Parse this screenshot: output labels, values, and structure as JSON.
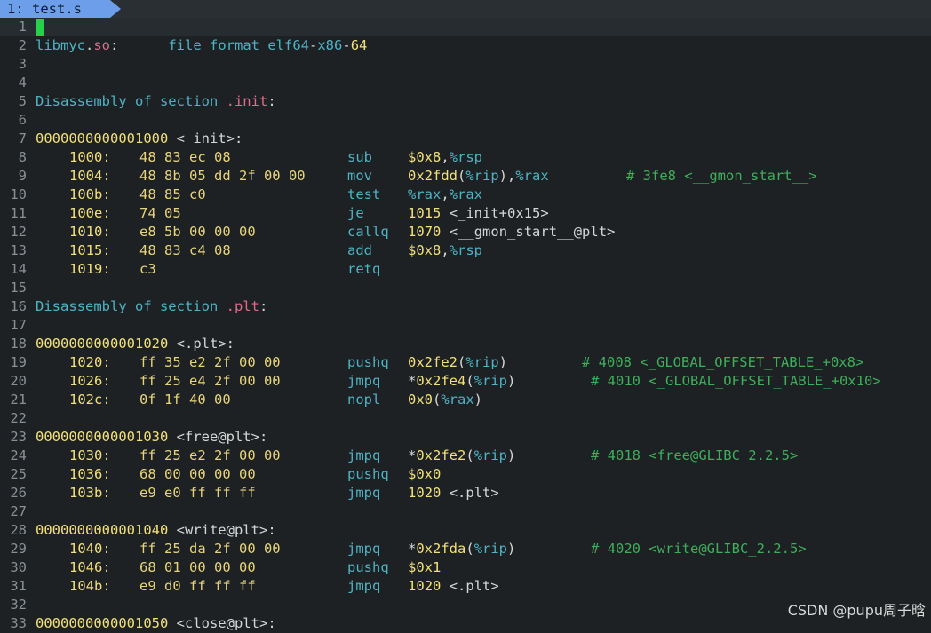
{
  "tab": {
    "label": "1: test.s"
  },
  "watermark": "CSDN @pupu周子晗",
  "lines": [
    {
      "n": "1",
      "kind": "cursor"
    },
    {
      "n": "2",
      "kind": "header",
      "a": "libmyc.so:",
      "b": "     file format elf64-x86-64"
    },
    {
      "n": "3",
      "kind": "blank"
    },
    {
      "n": "4",
      "kind": "blank"
    },
    {
      "n": "5",
      "kind": "section",
      "a": "Disassembly of section ",
      "b": ".init",
      ":": ":"
    },
    {
      "n": "6",
      "kind": "blank"
    },
    {
      "n": "7",
      "kind": "label",
      "a": "0000000000001000 <_init>:"
    },
    {
      "n": "8",
      "kind": "ins",
      "addr": "1000:",
      "bytes": "48 83 ec 08",
      "mn": "sub",
      "ops": "$0x8,%rsp",
      "cm": ""
    },
    {
      "n": "9",
      "kind": "ins",
      "addr": "1004:",
      "bytes": "48 8b 05 dd 2f 00 00",
      "mn": "mov",
      "ops": "0x2fdd(%rip),%rax",
      "cm": "# 3fe8 <__gmon_start__>",
      "cmx": "705"
    },
    {
      "n": "10",
      "kind": "ins",
      "addr": "100b:",
      "bytes": "48 85 c0",
      "mn": "test",
      "ops": "%rax,%rax",
      "cm": ""
    },
    {
      "n": "11",
      "kind": "ins",
      "addr": "100e:",
      "bytes": "74 05",
      "mn": "je",
      "ops": "1015 <_init+0x15>",
      "cm": ""
    },
    {
      "n": "12",
      "kind": "ins",
      "addr": "1010:",
      "bytes": "e8 5b 00 00 00",
      "mn": "callq",
      "ops": "1070 <__gmon_start__@plt>",
      "cm": ""
    },
    {
      "n": "13",
      "kind": "ins",
      "addr": "1015:",
      "bytes": "48 83 c4 08",
      "mn": "add",
      "ops": "$0x8,%rsp",
      "cm": ""
    },
    {
      "n": "14",
      "kind": "ins",
      "addr": "1019:",
      "bytes": "c3",
      "mn": "retq",
      "ops": "",
      "cm": ""
    },
    {
      "n": "15",
      "kind": "blank"
    },
    {
      "n": "16",
      "kind": "section",
      "a": "Disassembly of section ",
      "b": ".plt",
      ":": ":"
    },
    {
      "n": "17",
      "kind": "blank"
    },
    {
      "n": "18",
      "kind": "label",
      "a": "0000000000001020 <.plt>:"
    },
    {
      "n": "19",
      "kind": "ins",
      "addr": "1020:",
      "bytes": "ff 35 e2 2f 00 00",
      "mn": "pushq",
      "ops": "0x2fe2(%rip)",
      "cm": "# 4008 <_GLOBAL_OFFSET_TABLE_+0x8>",
      "cmx": "655"
    },
    {
      "n": "20",
      "kind": "ins",
      "addr": "1026:",
      "bytes": "ff 25 e4 2f 00 00",
      "mn": "jmpq",
      "ops": "*0x2fe4(%rip)",
      "cm": "# 4010 <_GLOBAL_OFFSET_TABLE_+0x10>",
      "cmx": "665"
    },
    {
      "n": "21",
      "kind": "ins",
      "addr": "102c:",
      "bytes": "0f 1f 40 00",
      "mn": "nopl",
      "ops": "0x0(%rax)",
      "cm": ""
    },
    {
      "n": "22",
      "kind": "blank"
    },
    {
      "n": "23",
      "kind": "label",
      "a": "0000000000001030 <free@plt>:"
    },
    {
      "n": "24",
      "kind": "ins",
      "addr": "1030:",
      "bytes": "ff 25 e2 2f 00 00",
      "mn": "jmpq",
      "ops": "*0x2fe2(%rip)",
      "cm": "# 4018 <free@GLIBC_2.2.5>",
      "cmx": "665"
    },
    {
      "n": "25",
      "kind": "ins",
      "addr": "1036:",
      "bytes": "68 00 00 00 00",
      "mn": "pushq",
      "ops": "$0x0",
      "cm": ""
    },
    {
      "n": "26",
      "kind": "ins",
      "addr": "103b:",
      "bytes": "e9 e0 ff ff ff",
      "mn": "jmpq",
      "ops": "1020 <.plt>",
      "cm": ""
    },
    {
      "n": "27",
      "kind": "blank"
    },
    {
      "n": "28",
      "kind": "label",
      "a": "0000000000001040 <write@plt>:"
    },
    {
      "n": "29",
      "kind": "ins",
      "addr": "1040:",
      "bytes": "ff 25 da 2f 00 00",
      "mn": "jmpq",
      "ops": "*0x2fda(%rip)",
      "cm": "# 4020 <write@GLIBC_2.2.5>",
      "cmx": "665"
    },
    {
      "n": "30",
      "kind": "ins",
      "addr": "1046:",
      "bytes": "68 01 00 00 00",
      "mn": "pushq",
      "ops": "$0x1",
      "cm": ""
    },
    {
      "n": "31",
      "kind": "ins",
      "addr": "104b:",
      "bytes": "e9 d0 ff ff ff",
      "mn": "jmpq",
      "ops": "1020 <.plt>",
      "cm": ""
    },
    {
      "n": "32",
      "kind": "blank"
    },
    {
      "n": "33",
      "kind": "label",
      "a": "0000000000001050 <close@plt>:"
    }
  ]
}
